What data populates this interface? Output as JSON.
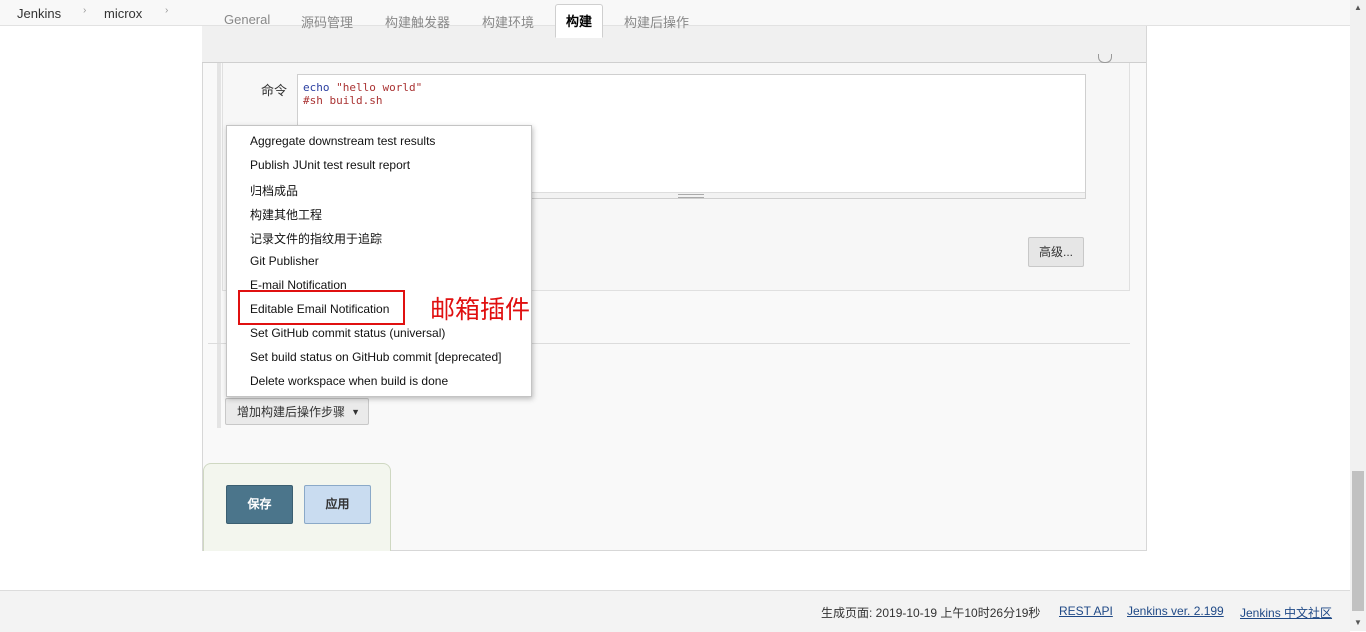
{
  "breadcrumb": {
    "items": [
      "Jenkins",
      "microx"
    ],
    "separator": "›"
  },
  "tabs": [
    {
      "label": "General",
      "active": false
    },
    {
      "label": "源码管理",
      "active": false
    },
    {
      "label": "构建触发器",
      "active": false
    },
    {
      "label": "构建环境",
      "active": false
    },
    {
      "label": "构建",
      "active": true
    },
    {
      "label": "构建后操作",
      "active": false
    }
  ],
  "build": {
    "command_label": "命令",
    "command_line1_prefix": "echo ",
    "command_line1_string": "\"hello world\"",
    "command_line2": "#sh build.sh",
    "advanced_button": "高级..."
  },
  "menu": {
    "items": [
      "Aggregate downstream test results",
      "Publish JUnit test result report",
      "归档成品",
      "构建其他工程",
      "记录文件的指纹用于追踪",
      "Git Publisher",
      "E-mail Notification",
      "Editable Email Notification",
      "Set GitHub commit status (universal)",
      "Set build status on GitHub commit [deprecated]",
      "Delete workspace when build is done"
    ],
    "highlighted": "Editable Email Notification",
    "annotation": "邮箱插件"
  },
  "post_build": {
    "add_step_button": "增加构建后操作步骤",
    "caret": "▼"
  },
  "actions": {
    "save": "保存",
    "apply": "应用"
  },
  "footer": {
    "generated": "生成页面: 2019-10-19 上午10时26分19秒",
    "rest_api": "REST API",
    "version": "Jenkins ver. 2.199",
    "community": "Jenkins 中文社区"
  },
  "colors": {
    "highlight": "#e01010",
    "save_button": "#4b758b",
    "apply_button": "#c9dcf0",
    "link": "#204a87"
  }
}
